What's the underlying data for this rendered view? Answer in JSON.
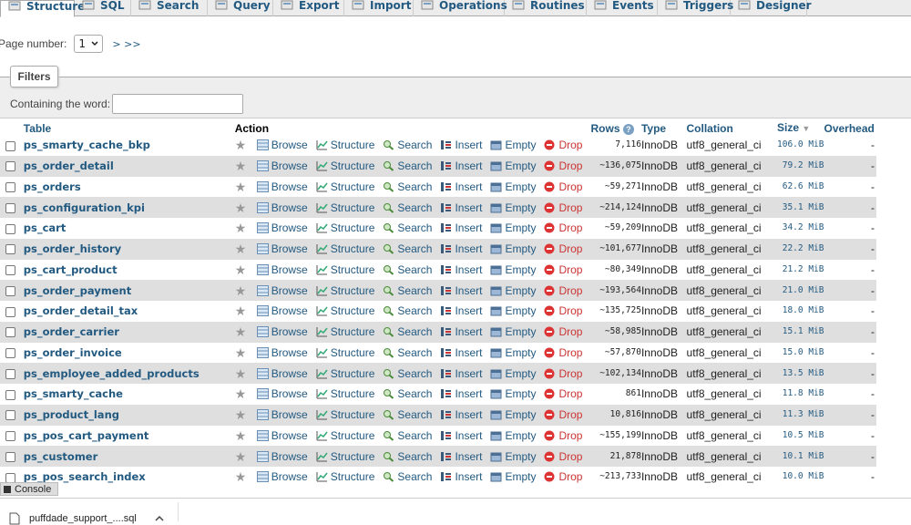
{
  "tabs": [
    {
      "label": "Structure",
      "icon": "structure-icon"
    },
    {
      "label": "SQL",
      "icon": "sql-icon"
    },
    {
      "label": "Search",
      "icon": "search-icon"
    },
    {
      "label": "Query",
      "icon": "query-icon"
    },
    {
      "label": "Export",
      "icon": "export-icon"
    },
    {
      "label": "Import",
      "icon": "import-icon"
    },
    {
      "label": "Operations",
      "icon": "wrench-icon"
    },
    {
      "label": "Routines",
      "icon": "routines-icon"
    },
    {
      "label": "Events",
      "icon": "clock-icon"
    },
    {
      "label": "Triggers",
      "icon": "triggers-icon"
    },
    {
      "label": "Designer",
      "icon": "designer-icon"
    }
  ],
  "pager": {
    "label": "Page number:",
    "value": "1",
    "nav": "> >>"
  },
  "filters": {
    "legend": "Filters",
    "label": "Containing the word:",
    "value": ""
  },
  "headers": {
    "table": "Table",
    "action": "Action",
    "rows": "Rows",
    "type": "Type",
    "collation": "Collation",
    "size": "Size",
    "overhead": "Overhead"
  },
  "actions": {
    "browse": "Browse",
    "structure": "Structure",
    "search": "Search",
    "insert": "Insert",
    "empty": "Empty",
    "drop": "Drop"
  },
  "rows": [
    {
      "name": "ps_smarty_cache_bkp",
      "rows": "7,116",
      "type": "InnoDB",
      "collation": "utf8_general_ci",
      "size": "106.0 MiB",
      "overhead": "-"
    },
    {
      "name": "ps_order_detail",
      "rows": "~136,075",
      "type": "InnoDB",
      "collation": "utf8_general_ci",
      "size": "79.2 MiB",
      "overhead": "-"
    },
    {
      "name": "ps_orders",
      "rows": "~59,271",
      "type": "InnoDB",
      "collation": "utf8_general_ci",
      "size": "62.6 MiB",
      "overhead": "-"
    },
    {
      "name": "ps_configuration_kpi",
      "rows": "~214,124",
      "type": "InnoDB",
      "collation": "utf8_general_ci",
      "size": "35.1 MiB",
      "overhead": "-"
    },
    {
      "name": "ps_cart",
      "rows": "~59,209",
      "type": "InnoDB",
      "collation": "utf8_general_ci",
      "size": "34.2 MiB",
      "overhead": "-"
    },
    {
      "name": "ps_order_history",
      "rows": "~101,677",
      "type": "InnoDB",
      "collation": "utf8_general_ci",
      "size": "22.2 MiB",
      "overhead": "-"
    },
    {
      "name": "ps_cart_product",
      "rows": "~80,349",
      "type": "InnoDB",
      "collation": "utf8_general_ci",
      "size": "21.2 MiB",
      "overhead": "-"
    },
    {
      "name": "ps_order_payment",
      "rows": "~193,564",
      "type": "InnoDB",
      "collation": "utf8_general_ci",
      "size": "21.0 MiB",
      "overhead": "-"
    },
    {
      "name": "ps_order_detail_tax",
      "rows": "~135,725",
      "type": "InnoDB",
      "collation": "utf8_general_ci",
      "size": "18.0 MiB",
      "overhead": "-"
    },
    {
      "name": "ps_order_carrier",
      "rows": "~58,985",
      "type": "InnoDB",
      "collation": "utf8_general_ci",
      "size": "15.1 MiB",
      "overhead": "-"
    },
    {
      "name": "ps_order_invoice",
      "rows": "~57,870",
      "type": "InnoDB",
      "collation": "utf8_general_ci",
      "size": "15.0 MiB",
      "overhead": "-"
    },
    {
      "name": "ps_employee_added_products",
      "rows": "~102,134",
      "type": "InnoDB",
      "collation": "utf8_general_ci",
      "size": "13.5 MiB",
      "overhead": "-"
    },
    {
      "name": "ps_smarty_cache",
      "rows": "861",
      "type": "InnoDB",
      "collation": "utf8_general_ci",
      "size": "11.8 MiB",
      "overhead": "-"
    },
    {
      "name": "ps_product_lang",
      "rows": "10,816",
      "type": "InnoDB",
      "collation": "utf8_general_ci",
      "size": "11.3 MiB",
      "overhead": "-"
    },
    {
      "name": "ps_pos_cart_payment",
      "rows": "~155,199",
      "type": "InnoDB",
      "collation": "utf8_general_ci",
      "size": "10.5 MiB",
      "overhead": "-"
    },
    {
      "name": "ps_customer",
      "rows": "21,878",
      "type": "InnoDB",
      "collation": "utf8_general_ci",
      "size": "10.1 MiB",
      "overhead": "-"
    },
    {
      "name": "ps_pos_search_index",
      "rows": "~213,733",
      "type": "InnoDB",
      "collation": "utf8_general_ci",
      "size": "10.0 MiB",
      "overhead": "-"
    }
  ],
  "console": {
    "label": "Console"
  },
  "download": {
    "filename": "puffdade_support_....sql"
  },
  "colors": {
    "link": "#235a81",
    "row_alt": "#dfdfdf",
    "drop": "#c33333",
    "header_bg": "#ececec"
  }
}
